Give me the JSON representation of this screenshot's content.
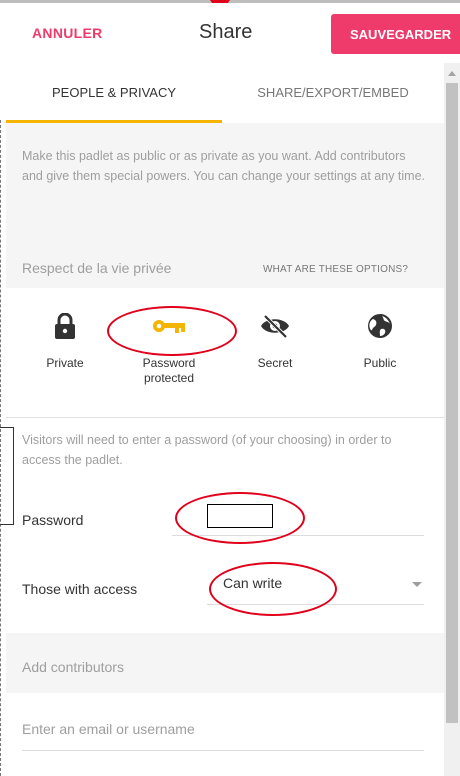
{
  "header": {
    "cancel_label": "ANNULER",
    "title": "Share",
    "save_label": "SAUVEGARDER"
  },
  "tabs": [
    {
      "label": "PEOPLE & PRIVACY",
      "active": true
    },
    {
      "label": "SHARE/EXPORT/EMBED",
      "active": false
    }
  ],
  "description": "Make this padlet as public or as private as you want. Add contributors and give them special powers. You can change your settings at any time.",
  "privacy": {
    "section_label": "Respect de la vie privée",
    "help_link": "WHAT ARE THESE OPTIONS?",
    "selected": "Password protected",
    "options": [
      {
        "label": "Private",
        "icon": "lock-icon"
      },
      {
        "label": "Password protected",
        "icon": "key-icon"
      },
      {
        "label": "Secret",
        "icon": "eye-off-icon"
      },
      {
        "label": "Public",
        "icon": "globe-icon"
      }
    ]
  },
  "visitors": {
    "text": "Visitors will need to enter a password (of your choosing) in order to access the padlet.",
    "password_label": "Password",
    "password_value": "",
    "access_label": "Those with access",
    "access_value": "Can write"
  },
  "contributors": {
    "label": "Add contributors",
    "placeholder": "Enter an email or username"
  },
  "colors": {
    "accent_pink": "#ee3b6b",
    "key_yellow": "#f4b400",
    "annotation_red": "#e0001b"
  }
}
